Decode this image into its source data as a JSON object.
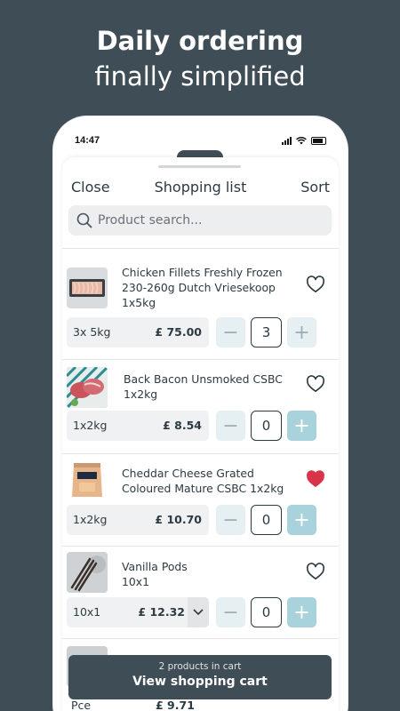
{
  "hero": {
    "line1": "Daily ordering",
    "line2": "finally simplified"
  },
  "status": {
    "time": "14:47"
  },
  "nav": {
    "close": "Close",
    "title": "Shopping list",
    "sort": "Sort"
  },
  "search": {
    "placeholder": "Product search..."
  },
  "products": [
    {
      "name": "Chicken Fillets Freshly Frozen 230-260g Dutch Vriesekoop 1x5kg",
      "unit": "3x 5kg",
      "price": "£ 75.00",
      "qty": "3",
      "favorite": false
    },
    {
      "name": "Back Bacon Unsmoked CSBC 1x2kg",
      "unit": "1x2kg",
      "price": "£ 8.54",
      "qty": "0",
      "favorite": false
    },
    {
      "name": "Cheddar Cheese Grated Coloured Mature CSBC 1x2kg",
      "unit": "1x2kg",
      "price": "£ 10.70",
      "qty": "0",
      "favorite": true
    },
    {
      "name": "Vanilla Pods 10x1",
      "unit": "10x1",
      "price": "£ 12.32",
      "qty": "0",
      "favorite": false
    }
  ],
  "partial_item": {
    "unit": "Pce",
    "price": "£ 9.71"
  },
  "cart": {
    "count_text": "2 products in cart",
    "button_label": "View shopping cart"
  },
  "colors": {
    "background": "#3e4d56",
    "accent": "#a9d3dc",
    "favorite": "#d9334a"
  }
}
